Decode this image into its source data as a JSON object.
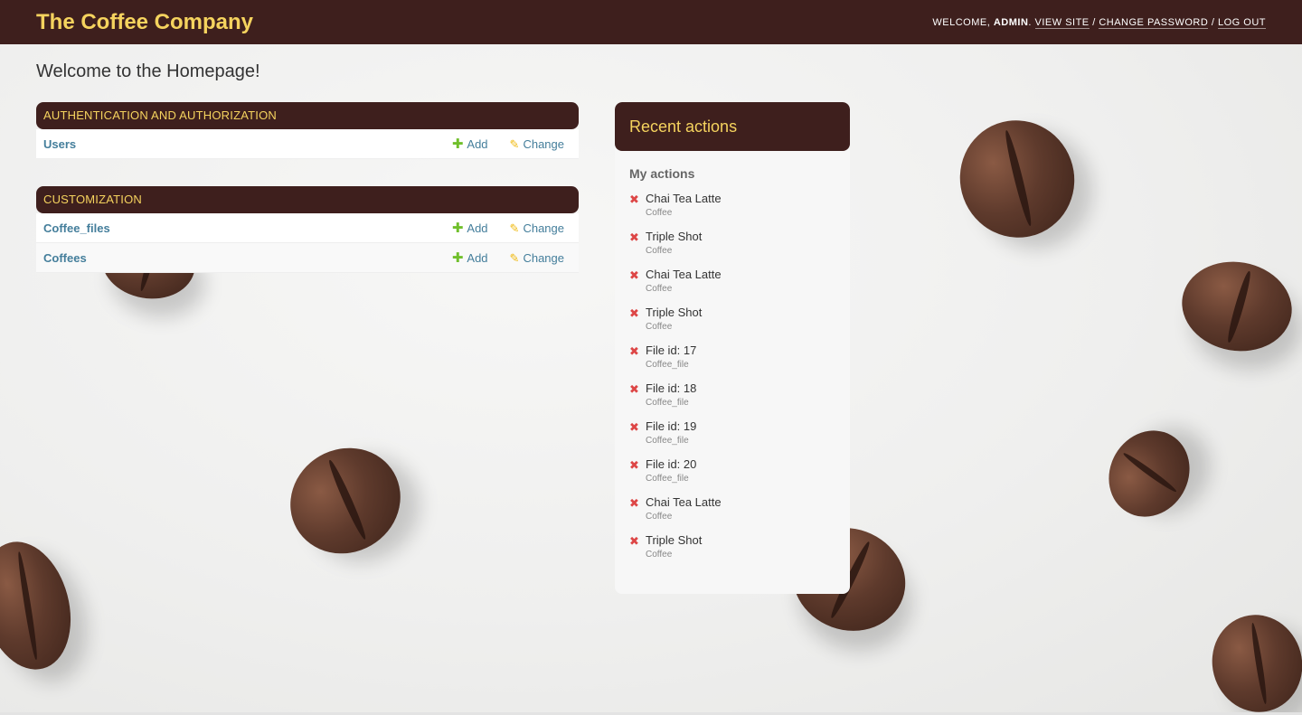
{
  "header": {
    "site_name": "The Coffee Company",
    "welcome": "WELCOME, ",
    "user": "ADMIN",
    "dot": ". ",
    "view_site": "VIEW SITE",
    "sep": " / ",
    "change_password": "CHANGE PASSWORD",
    "log_out": "LOG OUT"
  },
  "page": {
    "title": "Welcome to the Homepage!"
  },
  "modules": [
    {
      "caption": "AUTHENTICATION AND AUTHORIZATION",
      "rows": [
        {
          "name": "Users",
          "add": "Add",
          "change": "Change"
        }
      ]
    },
    {
      "caption": "CUSTOMIZATION",
      "rows": [
        {
          "name": "Coffee_files",
          "add": "Add",
          "change": "Change"
        },
        {
          "name": "Coffees",
          "add": "Add",
          "change": "Change"
        }
      ]
    }
  ],
  "recent": {
    "title": "Recent actions",
    "my_actions": "My actions",
    "items": [
      {
        "name": "Chai Tea Latte",
        "type": "Coffee"
      },
      {
        "name": "Triple Shot",
        "type": "Coffee"
      },
      {
        "name": "Chai Tea Latte",
        "type": "Coffee"
      },
      {
        "name": "Triple Shot",
        "type": "Coffee"
      },
      {
        "name": "File id: 17",
        "type": "Coffee_file"
      },
      {
        "name": "File id: 18",
        "type": "Coffee_file"
      },
      {
        "name": "File id: 19",
        "type": "Coffee_file"
      },
      {
        "name": "File id: 20",
        "type": "Coffee_file"
      },
      {
        "name": "Chai Tea Latte",
        "type": "Coffee"
      },
      {
        "name": "Triple Shot",
        "type": "Coffee"
      }
    ]
  },
  "icons": {
    "add": "plus-icon",
    "change": "pencil-icon",
    "delete": "delete-x-icon"
  },
  "colors": {
    "header_bg": "#3e1f1d",
    "brand": "#f5d35e",
    "link": "#447e9b",
    "add": "#70bf2b",
    "change": "#efb80b",
    "delete": "#dd4646"
  }
}
